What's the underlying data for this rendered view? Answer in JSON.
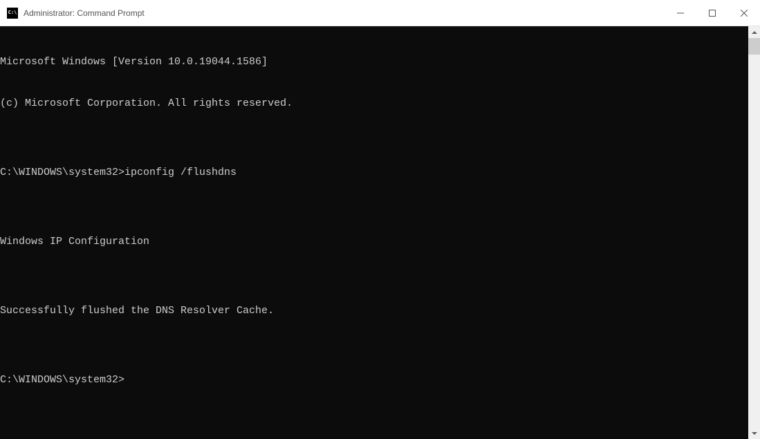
{
  "window": {
    "title": "Administrator: Command Prompt",
    "icon_label": "C:\\"
  },
  "terminal": {
    "lines": [
      "Microsoft Windows [Version 10.0.19044.1586]",
      "(c) Microsoft Corporation. All rights reserved.",
      "",
      "C:\\WINDOWS\\system32>ipconfig /flushdns",
      "",
      "Windows IP Configuration",
      "",
      "Successfully flushed the DNS Resolver Cache.",
      "",
      "C:\\WINDOWS\\system32>"
    ]
  }
}
